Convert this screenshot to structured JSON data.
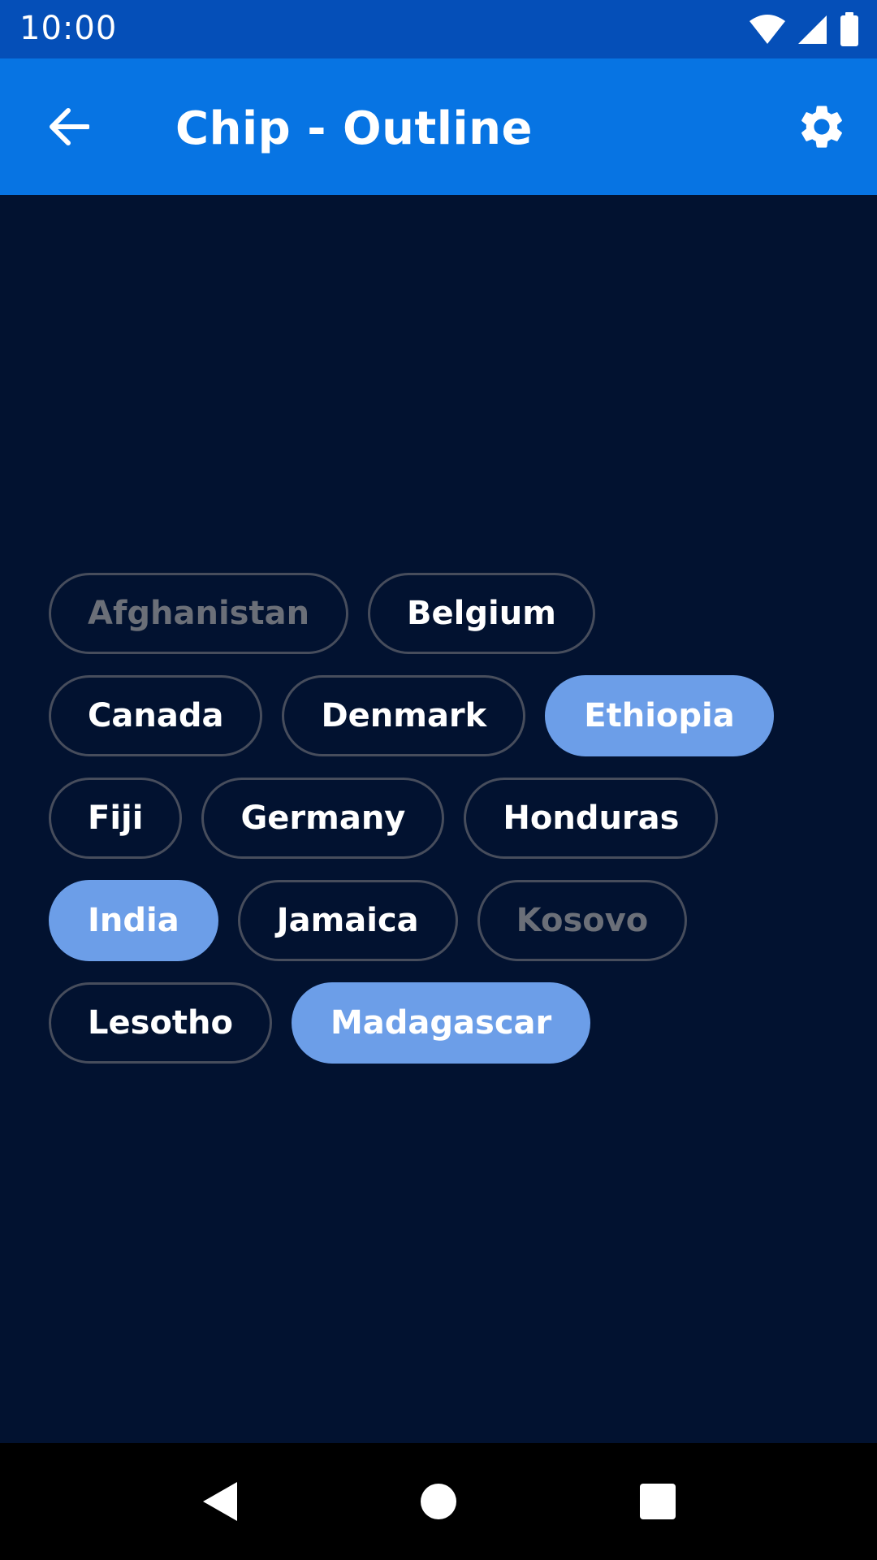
{
  "status_bar": {
    "time": "10:00"
  },
  "app_bar": {
    "title": "Chip - Outline",
    "background": "#0774e3"
  },
  "chips": [
    {
      "label": "Afghanistan",
      "state": "disabled"
    },
    {
      "label": "Belgium",
      "state": "default"
    },
    {
      "label": "Canada",
      "state": "default"
    },
    {
      "label": "Denmark",
      "state": "default"
    },
    {
      "label": "Ethiopia",
      "state": "selected"
    },
    {
      "label": "Fiji",
      "state": "default"
    },
    {
      "label": "Germany",
      "state": "default"
    },
    {
      "label": "Honduras",
      "state": "default"
    },
    {
      "label": "India",
      "state": "selected"
    },
    {
      "label": "Jamaica",
      "state": "default"
    },
    {
      "label": "Kosovo",
      "state": "disabled"
    },
    {
      "label": "Lesotho",
      "state": "default"
    },
    {
      "label": "Madagascar",
      "state": "selected"
    }
  ],
  "colors": {
    "background": "#021230",
    "status_bar": "#054fb8",
    "chip_selected": "#6c9ee8",
    "chip_outline": "#474d5c",
    "chip_disabled_text": "#6b6f78"
  },
  "icons": {
    "back": "arrow-back-icon",
    "settings": "gear-icon",
    "wifi": "wifi-icon",
    "signal": "signal-icon",
    "battery": "battery-icon",
    "nav_back": "triangle-back-icon",
    "nav_home": "circle-home-icon",
    "nav_recents": "square-recents-icon"
  }
}
